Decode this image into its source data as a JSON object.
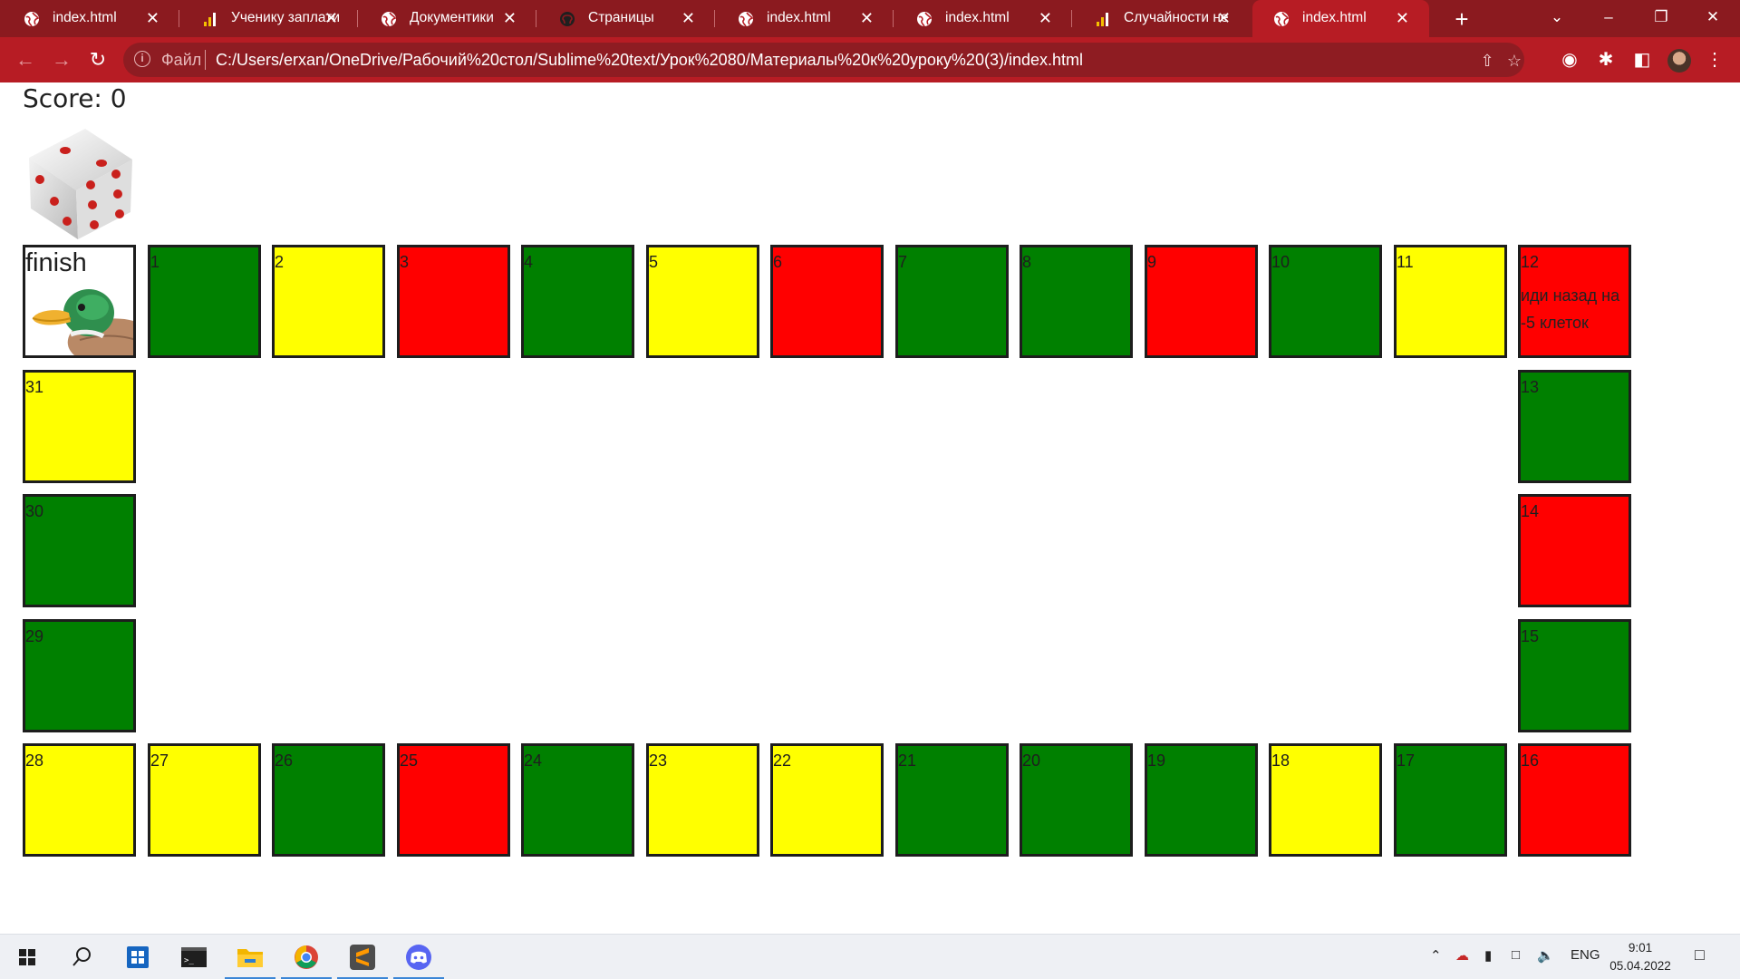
{
  "browser": {
    "tabs": [
      {
        "label": "index.html",
        "icon": "globe-icon"
      },
      {
        "label": "Ученику заплати",
        "icon": "bar-chart-icon"
      },
      {
        "label": "Документики",
        "icon": "globe-icon"
      },
      {
        "label": "Страницы",
        "icon": "github-icon"
      },
      {
        "label": "index.html",
        "icon": "globe-icon"
      },
      {
        "label": "index.html",
        "icon": "globe-icon"
      },
      {
        "label": "Случайности не",
        "icon": "bar-chart-icon"
      },
      {
        "label": "index.html",
        "icon": "globe-icon",
        "active": true
      }
    ],
    "address": {
      "scheme": "Файл",
      "url": "C:/Users/erxan/OneDrive/Рабочий%20стол/Sublime%20text/Урок%2080/Материалы%20к%20уроку%20(3)/index.html"
    }
  },
  "game": {
    "score_text": "Score: 0",
    "finish_label": "finish",
    "cell_colors": {
      "green": "#008000",
      "yellow": "#ffff00",
      "red": "#ff0000"
    },
    "cells": [
      {
        "n": "1",
        "color": "green"
      },
      {
        "n": "2",
        "color": "yellow"
      },
      {
        "n": "3",
        "color": "red"
      },
      {
        "n": "4",
        "color": "green"
      },
      {
        "n": "5",
        "color": "yellow"
      },
      {
        "n": "6",
        "color": "red"
      },
      {
        "n": "7",
        "color": "green"
      },
      {
        "n": "8",
        "color": "green"
      },
      {
        "n": "9",
        "color": "red"
      },
      {
        "n": "10",
        "color": "green"
      },
      {
        "n": "11",
        "color": "yellow"
      },
      {
        "n": "12",
        "color": "red",
        "note": "иди назад на -5 клеток"
      },
      {
        "n": "13",
        "color": "green"
      },
      {
        "n": "14",
        "color": "red"
      },
      {
        "n": "15",
        "color": "green"
      },
      {
        "n": "16",
        "color": "red"
      },
      {
        "n": "17",
        "color": "green"
      },
      {
        "n": "18",
        "color": "yellow"
      },
      {
        "n": "19",
        "color": "green"
      },
      {
        "n": "20",
        "color": "green"
      },
      {
        "n": "21",
        "color": "green"
      },
      {
        "n": "22",
        "color": "yellow"
      },
      {
        "n": "23",
        "color": "yellow"
      },
      {
        "n": "24",
        "color": "green"
      },
      {
        "n": "25",
        "color": "red"
      },
      {
        "n": "26",
        "color": "green"
      },
      {
        "n": "27",
        "color": "yellow"
      },
      {
        "n": "28",
        "color": "yellow"
      },
      {
        "n": "29",
        "color": "green"
      },
      {
        "n": "30",
        "color": "green"
      },
      {
        "n": "31",
        "color": "yellow"
      }
    ]
  },
  "taskbar": {
    "language": "ENG",
    "time": "9:01",
    "date": "05.04.2022"
  }
}
